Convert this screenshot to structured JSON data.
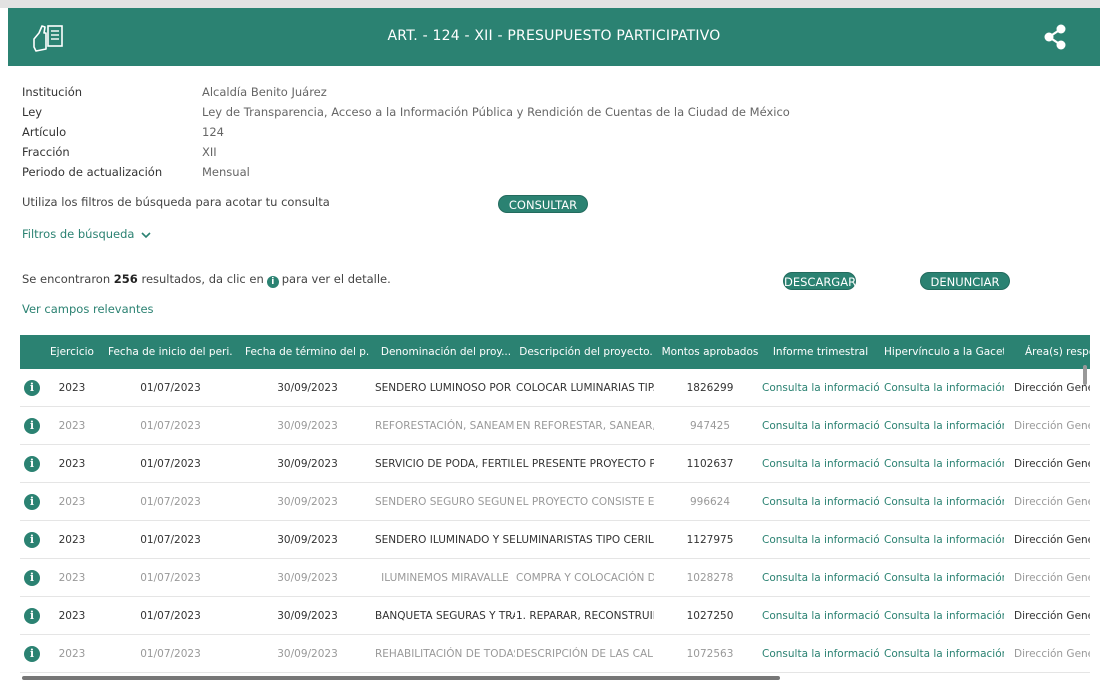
{
  "header": {
    "title": "ART. - 124 - XII - PRESUPUESTO PARTICIPATIVO",
    "logo_icon": "hand-document-icon",
    "share_icon": "share-icon",
    "color": "#2b8272"
  },
  "info": [
    {
      "label": "Institución",
      "value": "Alcaldía Benito Juárez"
    },
    {
      "label": "Ley",
      "value": "Ley de Transparencia, Acceso a la Información Pública y Rendición de Cuentas de la Ciudad de México"
    },
    {
      "label": "Artículo",
      "value": "124"
    },
    {
      "label": "Fracción",
      "value": "XII"
    },
    {
      "label": "Periodo de actualización",
      "value": "Mensual"
    }
  ],
  "filters": {
    "hint": "Utiliza los filtros de búsqueda para acotar tu consulta",
    "consultar_label": "CONSULTAR",
    "toggle_label": "Filtros de búsqueda"
  },
  "results": {
    "prefix": "Se encontraron",
    "count": "256",
    "middle": "resultados, da clic en",
    "suffix": "para ver el detalle.",
    "descargar_label": "DESCARGAR",
    "denunciar_label": "DENUNCIAR",
    "campos_label": "Ver campos relevantes"
  },
  "table": {
    "columns": [
      "Ejercicio",
      "Fecha de inicio del peri...",
      "Fecha de término del p...",
      "Denominación del proy...",
      "Descripción del proyecto.",
      "Montos aprobados",
      "Informe trimestral",
      "Hipervínculo a la Gacet...",
      "Área(s) respo"
    ],
    "rows": [
      [
        "2023",
        "01/07/2023",
        "30/09/2023",
        "SENDERO LUMINOSO POR ...",
        "COLOCAR LUMINARIAS TIP...",
        "1826299",
        "Consulta la información",
        "Consulta la información",
        "Dirección Gene"
      ],
      [
        "2023",
        "01/07/2023",
        "30/09/2023",
        "REFORESTACIÓN, SANEAMI...",
        "EN REFORESTAR, SANEAR, ...",
        "947425",
        "Consulta la información",
        "Consulta la información",
        "Dirección Gene"
      ],
      [
        "2023",
        "01/07/2023",
        "30/09/2023",
        "SERVICIO DE PODA, FERTILI...",
        "EL PRESENTE PROYECTO PR...",
        "1102637",
        "Consulta la información",
        "Consulta la información",
        "Dirección Gene"
      ],
      [
        "2023",
        "01/07/2023",
        "30/09/2023",
        "SENDERO SEGURO SEGUND...",
        "EL PROYECTO CONSISTE EN...",
        "996624",
        "Consulta la información",
        "Consulta la información",
        "Dirección Gene"
      ],
      [
        "2023",
        "01/07/2023",
        "30/09/2023",
        "SENDERO ILUMINADO Y SE...",
        "LUMINARISTAS TIPO CERILL...",
        "1127975",
        "Consulta la información",
        "Consulta la información",
        "Dirección Gene"
      ],
      [
        "2023",
        "01/07/2023",
        "30/09/2023",
        "ILUMINEMOS MIRAVALLE",
        "COMPRA Y COLOCACIÓN D...",
        "1028278",
        "Consulta la información",
        "Consulta la información",
        "Dirección Gene"
      ],
      [
        "2023",
        "01/07/2023",
        "30/09/2023",
        "BANQUETA SEGURAS Y TRA...",
        "1. REPARAR, RECONSTRUIR ...",
        "1027250",
        "Consulta la información",
        "Consulta la información",
        "Dirección Gene"
      ],
      [
        "2023",
        "01/07/2023",
        "30/09/2023",
        "REHABILITACIÓN DE TODAS...",
        "DESCRIPCIÓN DE LAS CALL...",
        "1072563",
        "Consulta la información",
        "Consulta la información",
        "Dirección Gene"
      ]
    ],
    "row_icon": "info-icon",
    "row_icon_glyph": "i"
  }
}
